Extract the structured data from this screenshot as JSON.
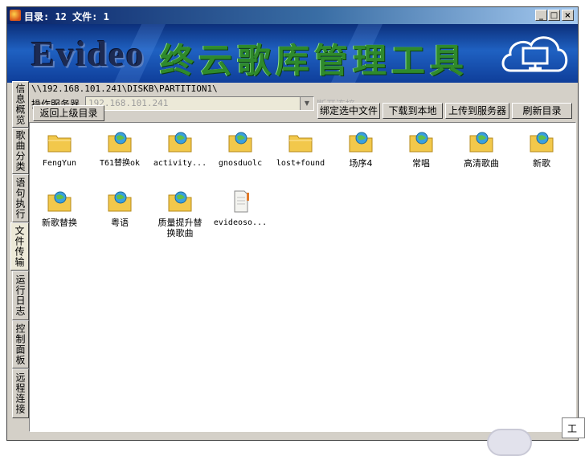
{
  "window": {
    "title": "目录: 12 文件: 1",
    "controls": {
      "minimize": "_",
      "maximize": "□",
      "close": "×"
    }
  },
  "banner": {
    "logo": "Evideo",
    "title": "终云歌库管理工具",
    "icon": "cloud-monitor-icon"
  },
  "sidebar": {
    "tabs": [
      {
        "label": "信息概览",
        "active": false
      },
      {
        "label": "歌曲分类",
        "active": false
      },
      {
        "label": "语句执行",
        "active": false
      },
      {
        "label": "文件传输",
        "active": true
      },
      {
        "label": "运行日志",
        "active": false
      },
      {
        "label": "控制面板",
        "active": false
      },
      {
        "label": "远程连接",
        "active": false
      }
    ]
  },
  "toolbar": {
    "path": "\\\\192.168.101.241\\DISKB\\PARTITION1\\",
    "server_label": "操作服务器",
    "server_value": "192.168.101.241",
    "disconnect_label": "断开连接",
    "up_label": "返回上级目录",
    "bind_label": "绑定选中文件",
    "download_label": "下载到本地",
    "upload_label": "上传到服务器",
    "refresh_label": "刷新目录"
  },
  "files": [
    {
      "name": "FengYun",
      "icon": "folder-icon"
    },
    {
      "name": "T61替换ok",
      "icon": "folder-network-icon"
    },
    {
      "name": "activity...",
      "icon": "folder-network-icon"
    },
    {
      "name": "gnosduolc",
      "icon": "folder-network-icon"
    },
    {
      "name": "lost+found",
      "icon": "folder-icon"
    },
    {
      "name": "场序4",
      "icon": "folder-network-icon"
    },
    {
      "name": "常唱",
      "icon": "folder-network-icon"
    },
    {
      "name": "高清歌曲",
      "icon": "folder-network-icon"
    },
    {
      "name": "新歌",
      "icon": "folder-network-icon"
    },
    {
      "name": "新歌替换",
      "icon": "folder-network-icon"
    },
    {
      "name": "粤语",
      "icon": "folder-network-icon"
    },
    {
      "name": "质量提升替换歌曲",
      "icon": "folder-network-icon"
    },
    {
      "name": "evideoso...",
      "icon": "file-icon"
    }
  ],
  "overlay": {
    "peek_label": "工"
  },
  "colors": {
    "titlebar": "#0a246a",
    "banner": "#1f61c2",
    "banner_text": "#2f8a2c",
    "folder": "#f2c84b"
  }
}
